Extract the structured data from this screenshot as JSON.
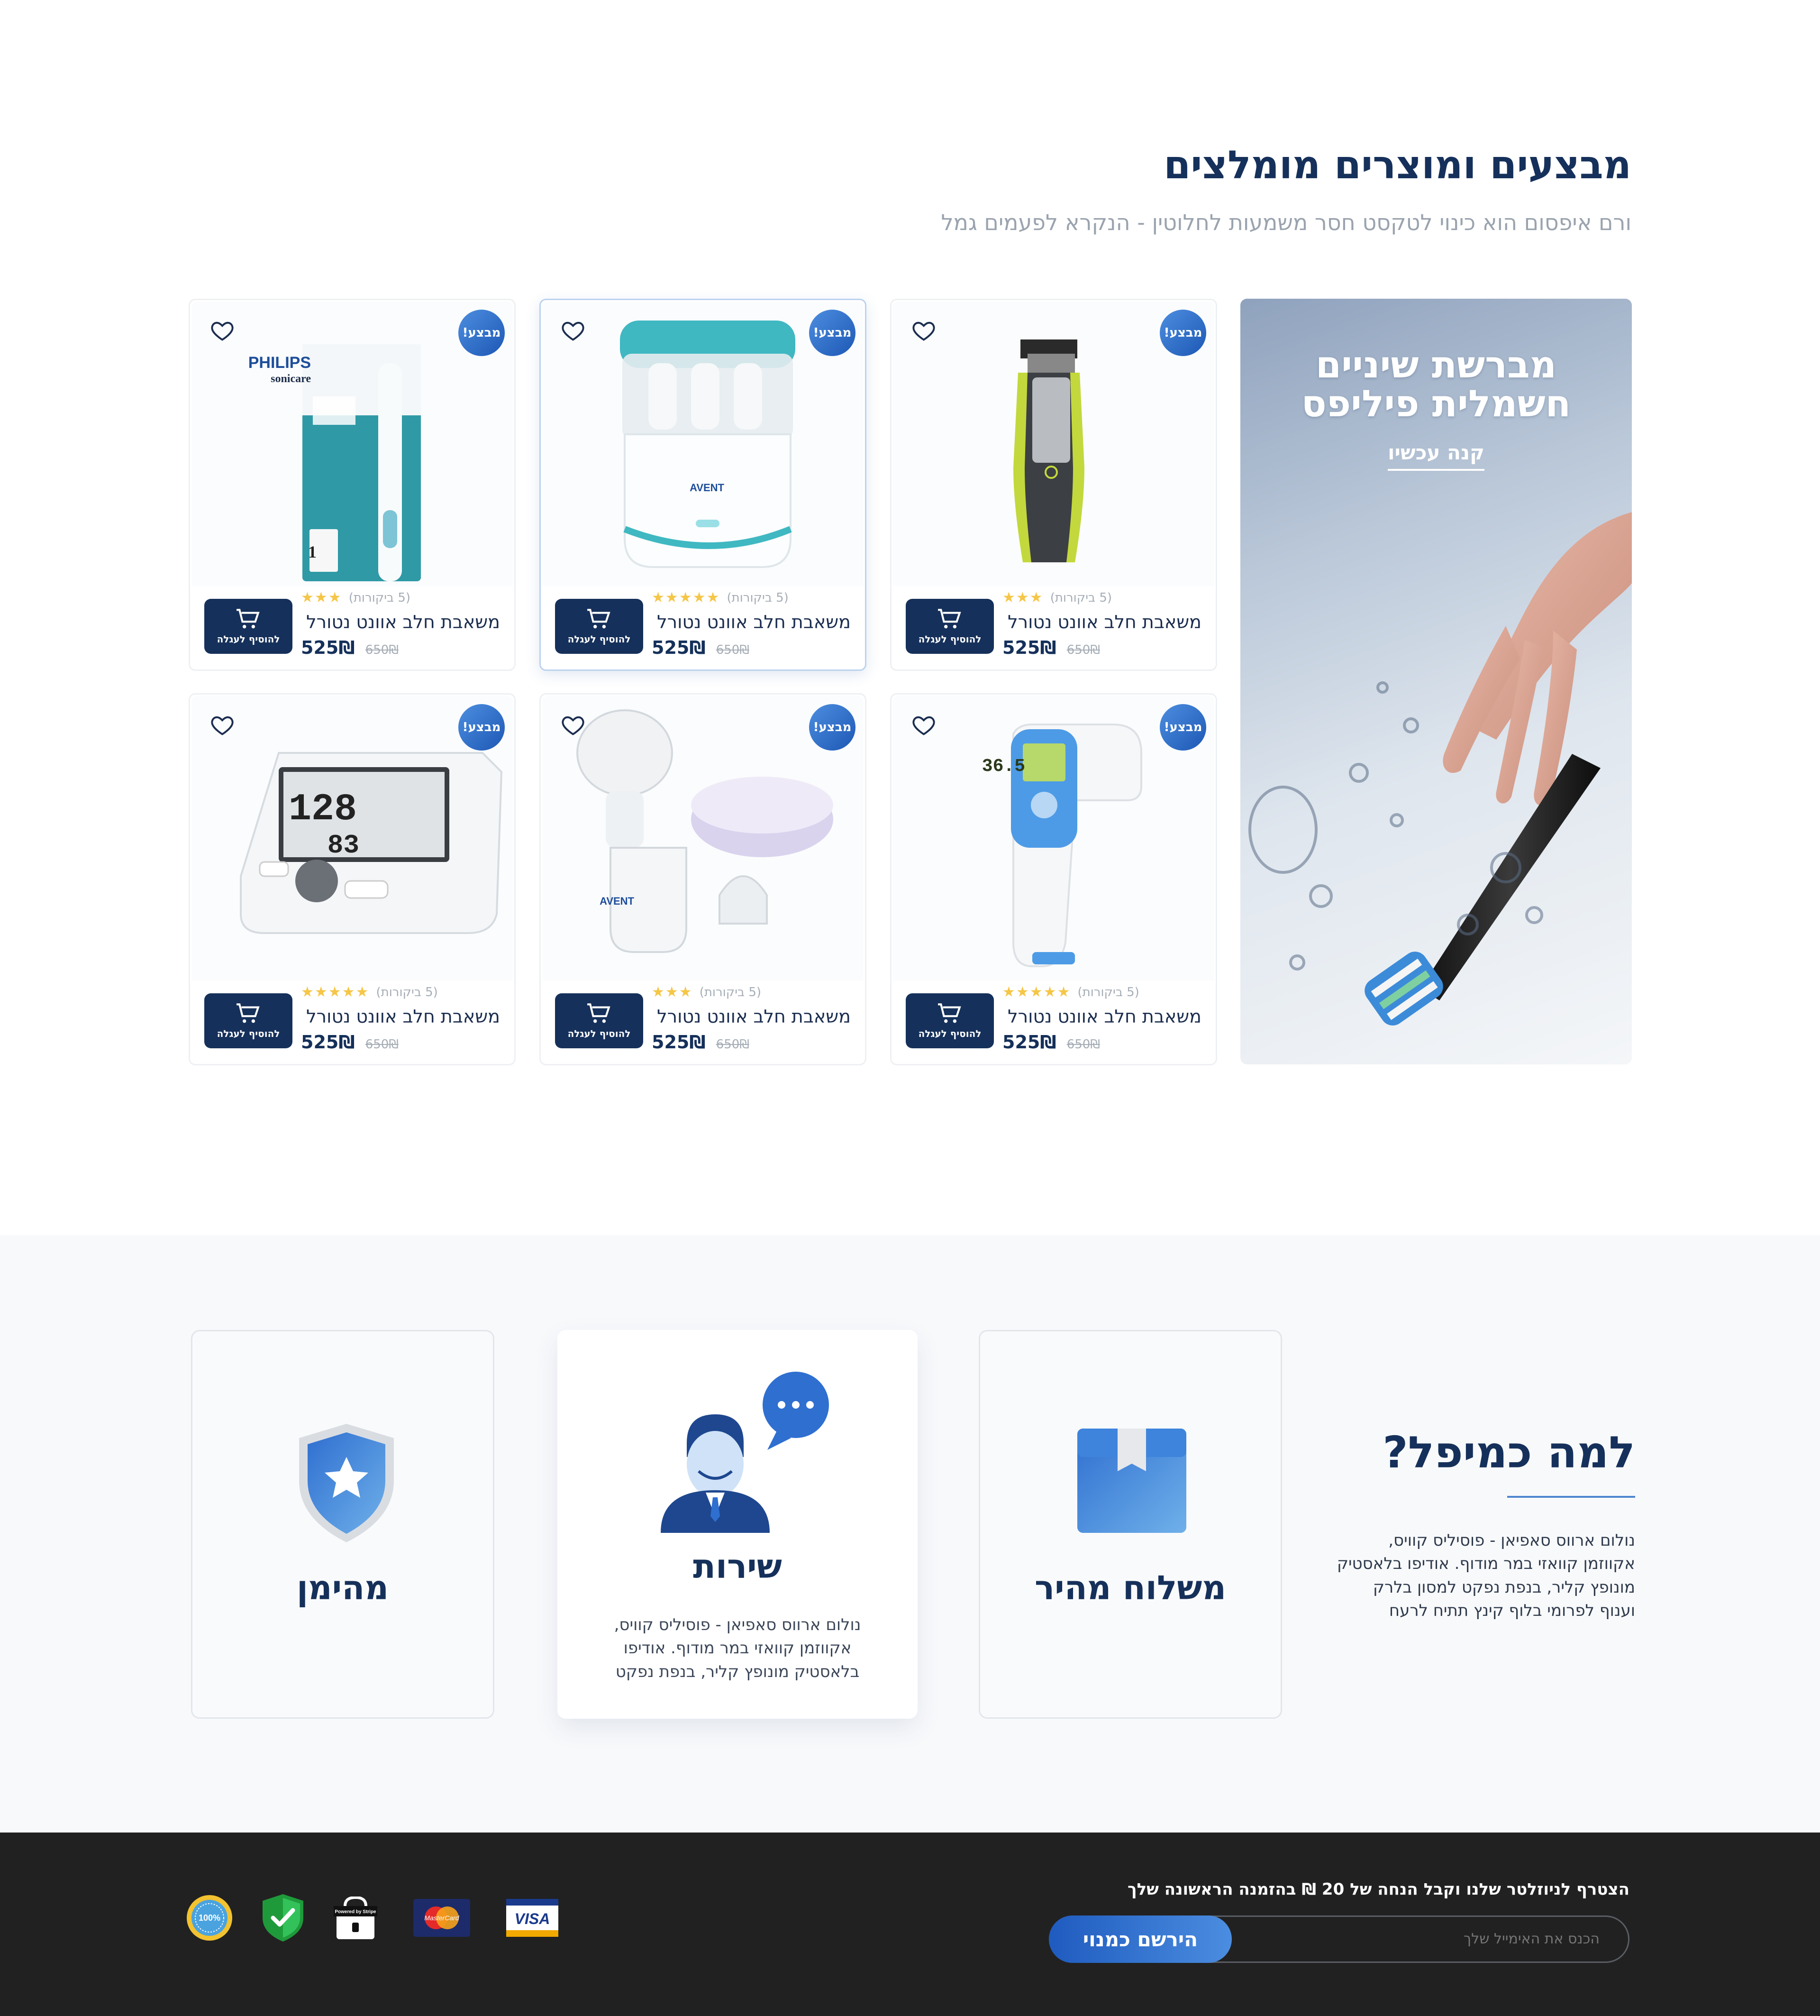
{
  "deals": {
    "title": "מבצעים ומוצרים מומלצים",
    "subtitle": "ורם איפסום הוא כינוי לטקסט חסר משמעות לחלוטין - הנקרא לפעמים גמל"
  },
  "promo": {
    "title_line1": "מברשת שיניים",
    "title_line2": "חשמלית פיליפס",
    "link": "קנה עכשיו"
  },
  "products": [
    {
      "badge": "מבצע!",
      "image": "philips-toothbrush-box",
      "stars": 3,
      "reviews": "(5 ביקורות)",
      "name": "משאבת חלב אוונט נטורל",
      "price": "525₪",
      "old_price": "650₪",
      "cart_label": "להוסיף לעגלה"
    },
    {
      "badge": "מבצע!",
      "image": "bottle-sterilizer",
      "stars": 5,
      "reviews": "(5 ביקורות)",
      "name": "משאבת חלב אוונט נטורל",
      "price": "525₪",
      "old_price": "650₪",
      "cart_label": "להוסיף לעגלה"
    },
    {
      "badge": "מבצע!",
      "image": "philips-oneblade-trimmer",
      "stars": 3,
      "reviews": "(5 ביקורות)",
      "name": "משאבת חלב אוונט נטורל",
      "price": "525₪",
      "old_price": "650₪",
      "cart_label": "להוסיף לעגלה"
    },
    {
      "badge": "מבצע!",
      "image": "blood-pressure-monitor",
      "stars": 5,
      "reviews": "(5 ביקורות)",
      "name": "משאבת חלב אוונט נטורל",
      "price": "525₪",
      "old_price": "650₪",
      "cart_label": "להוסיף לעגלה"
    },
    {
      "badge": "מבצע!",
      "image": "avent-breast-pump",
      "stars": 3,
      "reviews": "(5 ביקורות)",
      "name": "משאבת חלב אוונט נטורל",
      "price": "525₪",
      "old_price": "650₪",
      "cart_label": "להוסיף לעגלה"
    },
    {
      "badge": "מבצע!",
      "image": "infrared-thermometer",
      "stars": 5,
      "reviews": "(5 ביקורות)",
      "name": "משאבת חלב אוונט נטורל",
      "price": "525₪",
      "old_price": "650₪",
      "cart_label": "להוסיף לעגלה"
    }
  ],
  "thermo_display": "36.5",
  "why": {
    "title": "למה כמיפל?",
    "text_lines": [
      "נולום ארווס סאפיאן - פוסיליס קוויס,",
      "אקווזמן קוואזי במר מודוף. אודיפו בלאסטיק",
      "מונופץ קליר, בנפת נפקט למסון בלרק",
      "וענוף לפרומי בלוף קינץ תתיח לרעח"
    ],
    "features": {
      "shipping": {
        "title": "משלוח מהיר",
        "icon": "box-icon"
      },
      "service": {
        "title": "שירות",
        "icon": "support-agent-icon",
        "text_lines": [
          "נולום ארווס סאפיאן - פוסיליס קוויס,",
          "אקווזמן קוואזי במר מודוף. אודיפו",
          "בלאסטיק מונופץ קליר, בנפת נפקט"
        ]
      },
      "trusted": {
        "title": "מהימן",
        "icon": "shield-star-icon"
      }
    }
  },
  "footer": {
    "newsletter_title": "הצטרף לניוזלטר שלנו וקבל הנחה של 20 ₪ בהזמנה הראשונה שלך",
    "email_placeholder": "הכנס את האימייל שלך",
    "signup_label": "הירשם כמנוי",
    "payment": {
      "visa": "VISA",
      "mastercard": "MasterCard",
      "stripe": "Powered by Stripe",
      "secure": "secure-check",
      "guarantee": "100%"
    }
  },
  "colors": {
    "navy": "#15305a",
    "accent": "#2f6fd0",
    "footer_bg": "#212121",
    "star": "#f5c647"
  }
}
